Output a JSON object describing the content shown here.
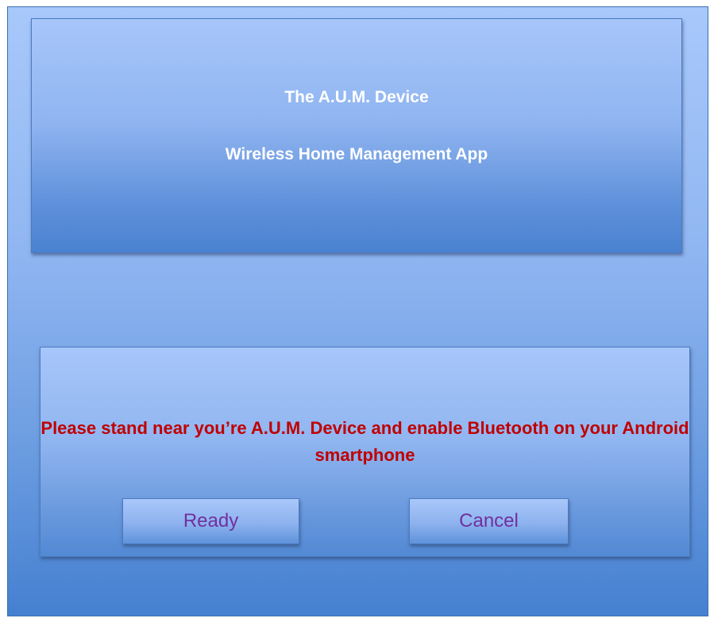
{
  "header": {
    "title": "The A.U.M. Device",
    "subtitle": "Wireless Home Management App"
  },
  "prompt": {
    "message": "Please stand near you’re A.U.M. Device and enable Bluetooth on your Android smartphone",
    "ready_label": "Ready",
    "cancel_label": "Cancel"
  },
  "colors": {
    "title_text": "#ffffff",
    "message_text": "#c00000",
    "button_text": "#7030a0",
    "panel_blue": "#8fb4f0"
  }
}
